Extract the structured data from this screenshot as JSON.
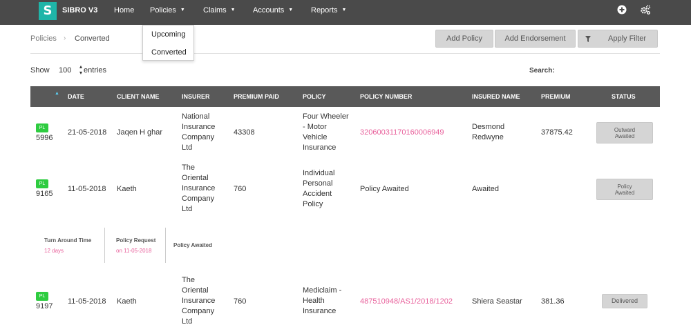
{
  "app": {
    "logo_letter": "S",
    "brand": "SIBRO V3"
  },
  "nav": [
    {
      "label": "Home",
      "caret": false
    },
    {
      "label": "Policies",
      "caret": true
    },
    {
      "label": "Claims",
      "caret": true
    },
    {
      "label": "Accounts",
      "caret": true
    },
    {
      "label": "Reports",
      "caret": true
    }
  ],
  "dropdown": {
    "items": [
      "Upcoming",
      "Converted"
    ]
  },
  "breadcrumb": {
    "parent": "Policies",
    "separator": "›",
    "current": "Converted"
  },
  "buttons": {
    "add_policy": "Add Policy",
    "add_endorsement": "Add Endorsement",
    "apply_filter": "Apply Filter"
  },
  "entries": {
    "show": "Show",
    "value": "100",
    "label": "entries"
  },
  "search": {
    "label": "Search:"
  },
  "columns": [
    "DATE",
    "CLIENT NAME",
    "INSURER",
    "PREMIUM PAID",
    "POLICY",
    "POLICY NUMBER",
    "INSURED NAME",
    "PREMIUM",
    "STATUS"
  ],
  "rows": [
    {
      "badge": "PL",
      "id": "5996",
      "date": "21-05-2018",
      "client": "Jaqen H ghar",
      "insurer": [
        "National",
        "Insurance",
        "Company",
        "Ltd"
      ],
      "premium_paid": "43308",
      "policy": [
        "Four Wheeler",
        "- Motor",
        "Vehicle",
        "Insurance"
      ],
      "policy_number": "32060031170160006949",
      "insured": [
        "Desmond",
        "Redwyne"
      ],
      "premium": "37875.42",
      "status": [
        "Outward",
        "Awaited"
      ]
    },
    {
      "badge": "PL",
      "id": "9165",
      "date": "11-05-2018",
      "client": "Kaeth",
      "insurer": [
        "The",
        "Oriental",
        "Insurance",
        "Company",
        "Ltd"
      ],
      "premium_paid": "760",
      "policy": [
        "Individual",
        "Personal",
        "Accident",
        "Policy"
      ],
      "policy_number": "Policy Awaited",
      "insured": [
        "Awaited"
      ],
      "premium": "",
      "status": [
        "Policy",
        "Awaited"
      ]
    },
    {
      "badge": "PL",
      "id": "9197",
      "date": "11-05-2018",
      "client": "Kaeth",
      "insurer": [
        "The",
        "Oriental",
        "Insurance",
        "Company",
        "Ltd"
      ],
      "premium_paid": "760",
      "policy": [
        "Mediclaim -",
        "Health",
        "Insurance"
      ],
      "policy_number": "487510948/AS1/2018/1202",
      "insured": [
        "Shiera Seastar"
      ],
      "premium": "381.36",
      "status": [
        "Delivered"
      ]
    }
  ],
  "timeline": {
    "turnaround_title": "Turn Around Time",
    "turnaround_value": "12 days",
    "request_title": "Policy Request",
    "request_value": "on 11-05-2018",
    "awaited_title": "Policy Awaited"
  }
}
